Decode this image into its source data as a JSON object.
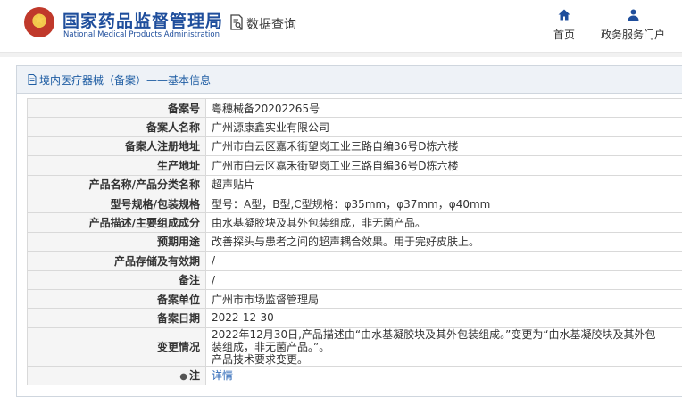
{
  "header": {
    "brand_cn": "国家药品监督管理局",
    "brand_en": "National Medical Products Administration",
    "query_label": "数据查询",
    "nav": {
      "home": "首页",
      "service": "政务服务门户"
    }
  },
  "panel": {
    "title": "境内医疗器械（备案）——基本信息"
  },
  "rows": [
    {
      "label": "备案号",
      "value": "粤穗械备20202265号"
    },
    {
      "label": "备案人名称",
      "value": "广州源康鑫实业有限公司"
    },
    {
      "label": "备案人注册地址",
      "value": "广州市白云区嘉禾街望岗工业三路自编36号D栋六楼"
    },
    {
      "label": "生产地址",
      "value": "广州市白云区嘉禾街望岗工业三路自编36号D栋六楼"
    },
    {
      "label": "产品名称/产品分类名称",
      "value": "超声贴片"
    },
    {
      "label": "型号规格/包装规格",
      "value": "型号：A型，B型,C型规格：φ35mm，φ37mm，φ40mm"
    },
    {
      "label": "产品描述/主要组成成分",
      "value": "由水基凝胶块及其外包装组成，非无菌产品。"
    },
    {
      "label": "预期用途",
      "value": "改善探头与患者之间的超声耦合效果。用于完好皮肤上。"
    },
    {
      "label": "产品存储及有效期",
      "value": "/"
    },
    {
      "label": "备注",
      "value": "/"
    },
    {
      "label": "备案单位",
      "value": "广州市市场监督管理局"
    },
    {
      "label": "备案日期",
      "value": "2022-12-30"
    },
    {
      "label": "变更情况",
      "value_line1": "2022年12月30日,产品描述由“由水基凝胶块及其外包装组成。”变更为“由水基凝胶块及其外包",
      "value_line2": "装组成，非无菌产品。”。",
      "value_line3": "产品技术要求变更。"
    },
    {
      "label": "注",
      "value": "详情"
    }
  ]
}
